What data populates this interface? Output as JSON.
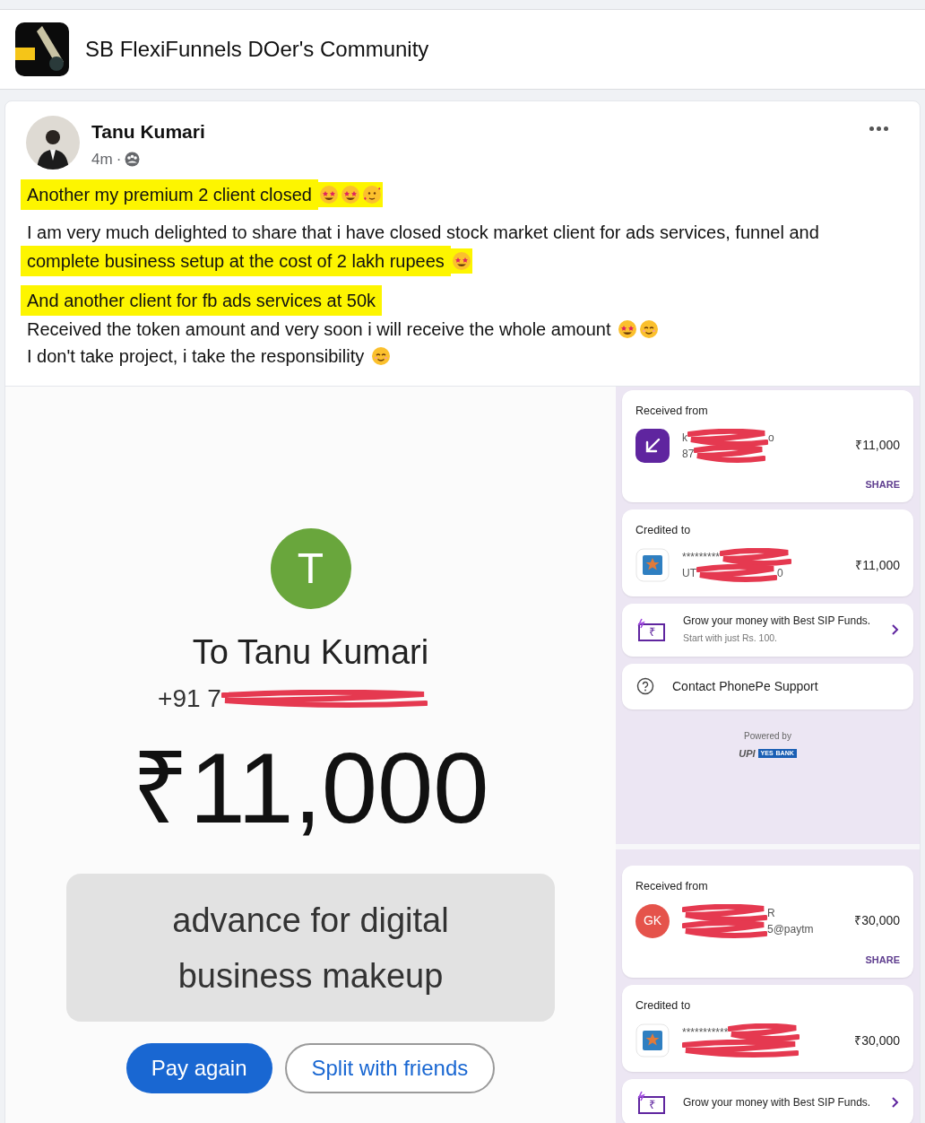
{
  "group": {
    "name": "SB FlexiFunnels DOer's Community"
  },
  "post": {
    "author": "Tanu Kumari",
    "time": "4m",
    "separator": "·",
    "paragraphs": [
      {
        "segments": [
          {
            "kind": "text",
            "text": "Another my premium 2 client closed",
            "highlighted": true
          },
          {
            "kind": "star-struck",
            "highlighted": true
          },
          {
            "kind": "star-struck",
            "highlighted": true
          },
          {
            "kind": "hearts",
            "highlighted": true
          }
        ]
      },
      {
        "segments": [
          {
            "kind": "text",
            "text": "I am very much delighted to share that i have closed stock market client for ads services, funnel and",
            "highlighted": false
          },
          {
            "kind": "text",
            "text": "complete business setup at the cost of 2 lakh rupees",
            "highlighted": true
          },
          {
            "kind": "star-struck",
            "highlighted": true
          }
        ]
      },
      {
        "segments": [
          {
            "kind": "text",
            "text": "And another client for fb ads services at 50k",
            "highlighted": true
          }
        ]
      },
      {
        "segments": [
          {
            "kind": "text",
            "text": "Received the token amount and very soon i will receive the whole amount",
            "highlighted": false
          },
          {
            "kind": "star-struck",
            "highlighted": false
          },
          {
            "kind": "smiling",
            "highlighted": false
          }
        ]
      },
      {
        "segments": [
          {
            "kind": "text",
            "text": "I don't take project, i take the responsibility",
            "highlighted": false
          },
          {
            "kind": "smiling",
            "highlighted": false
          }
        ]
      }
    ]
  },
  "payment": {
    "initial": "T",
    "recipient": "To Tanu Kumari",
    "phone_visible": "+91 7",
    "amount": "₹11,000",
    "note": "advance for digital business makeup",
    "buttons": [
      {
        "label": "Pay again",
        "kind": "filled"
      },
      {
        "label": "Split with friends",
        "kind": "outlined"
      }
    ]
  },
  "receipt_screens": [
    {
      "cards": [
        {
          "kind": "received",
          "label": "Received from",
          "avatar": {
            "kind": "arrow"
          },
          "lines": [
            {
              "kind": "between",
              "parts": [
                "k",
                "o"
              ]
            },
            {
              "kind": "after",
              "parts": [
                "87"
              ]
            }
          ],
          "amount": "₹11,000",
          "action": "SHARE"
        },
        {
          "kind": "credited",
          "label": "Credited to",
          "lines": [
            {
              "kind": "after",
              "parts": [
                "*********"
              ]
            },
            {
              "kind": "between",
              "parts": [
                "UT",
                "0"
              ]
            }
          ],
          "amount": "₹11,000"
        },
        {
          "kind": "promo",
          "symbol": "₹",
          "title": "Grow your money with Best SIP Funds.",
          "subtitle": "Start with just Rs. 100."
        },
        {
          "kind": "support",
          "title": "Contact PhonePe Support"
        }
      ],
      "footer": {
        "powered_by": "Powered by",
        "upi": "UPI",
        "bank_left": "YES",
        "bank_right": "BANK"
      }
    },
    {
      "cards": [
        {
          "kind": "received",
          "label": "Received from",
          "avatar": {
            "kind": "initials",
            "text": "GK",
            "color": "#e5534b"
          },
          "lines": [
            {
              "kind": "before",
              "parts": [
                "R"
              ]
            },
            {
              "kind": "before",
              "parts": [
                "5@paytm"
              ]
            }
          ],
          "amount": "₹30,000",
          "action": "SHARE"
        },
        {
          "kind": "credited",
          "label": "Credited to",
          "lines": [
            {
              "kind": "after",
              "parts": [
                "***********"
              ]
            },
            {
              "kind": "only"
            }
          ],
          "amount": "₹30,000"
        },
        {
          "kind": "promo",
          "symbol": "₹",
          "title": "Grow your money with Best SIP Funds."
        }
      ]
    }
  ]
}
